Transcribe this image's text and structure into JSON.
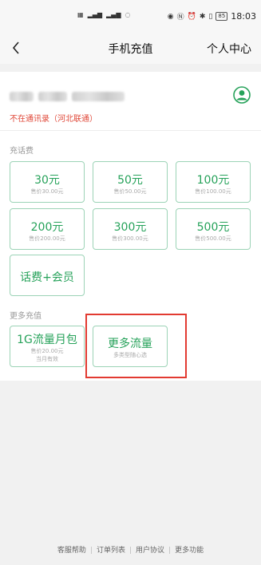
{
  "status_bar": {
    "left_indicators": "⊞ ᴴᴰ.││ ⁵ᴳ.││ ⊘",
    "right_indicators": "◉ Ⓝ ⏰ ✱ ▯",
    "battery": "85",
    "time": "18:03"
  },
  "nav": {
    "back_icon": "chevron-left-icon",
    "title": "手机充值",
    "right_link": "个人中心"
  },
  "account": {
    "user_icon": "user-circle-icon",
    "note": "不在通讯录（河北联通）"
  },
  "recharge": {
    "label": "充话费",
    "options": [
      {
        "amount": "30元",
        "price": "售价30.00元"
      },
      {
        "amount": "50元",
        "price": "售价50.00元"
      },
      {
        "amount": "100元",
        "price": "售价100.00元"
      },
      {
        "amount": "200元",
        "price": "售价200.00元"
      },
      {
        "amount": "300元",
        "price": "售价300.00元"
      },
      {
        "amount": "500元",
        "price": "售价500.00元"
      }
    ],
    "combo_label": "话费+会员"
  },
  "more": {
    "label": "更多充值",
    "data_pack": {
      "title": "1G流量月包",
      "price": "售价20.00元",
      "validity": "当月有效"
    },
    "more_data": {
      "title": "更多流量",
      "subtitle": "多类型随心选"
    }
  },
  "footer": {
    "links": [
      "客服帮助",
      "订单列表",
      "用户协议",
      "更多功能"
    ]
  },
  "colors": {
    "accent": "#26a25a",
    "tile_border": "#9cd3b6",
    "warning": "#e0493a",
    "highlight": "#e23a31"
  }
}
